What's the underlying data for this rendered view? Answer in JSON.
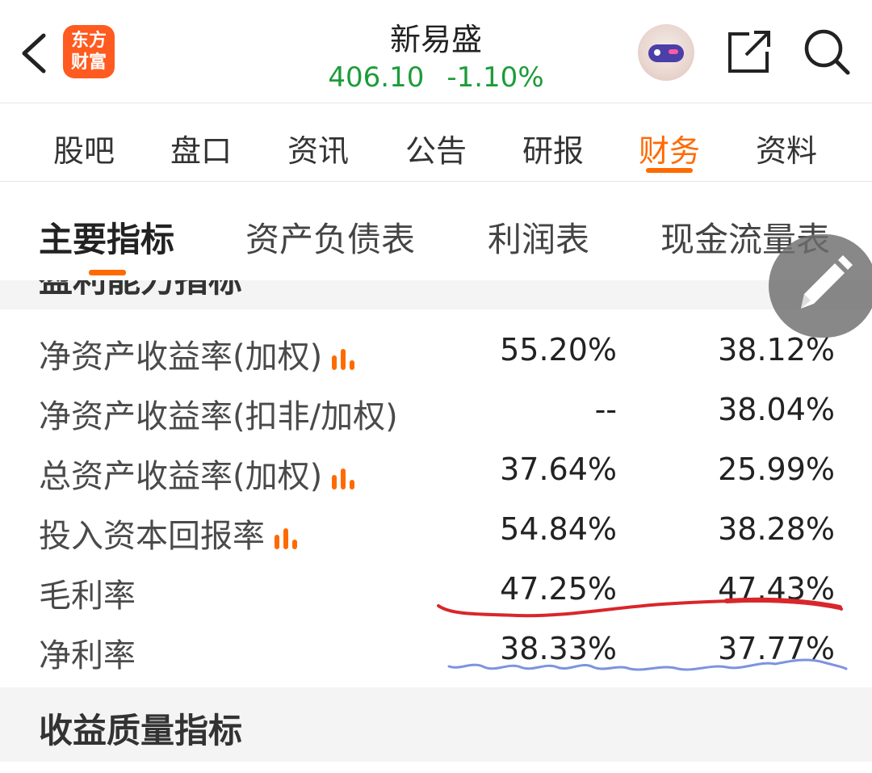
{
  "header": {
    "logo_line1": "东方",
    "logo_line2": "财富",
    "stock_name": "新易盛",
    "price": "406.10",
    "change_pct": "-1.10%"
  },
  "nav": {
    "tabs": [
      "股吧",
      "盘口",
      "资讯",
      "公告",
      "研报",
      "财务",
      "资料"
    ],
    "active": "财务"
  },
  "subnav": {
    "tabs": [
      "主要指标",
      "资产负债表",
      "利润表",
      "现金流量表"
    ],
    "active": "主要指标"
  },
  "section_partial_title": "盈利能力指标",
  "rows": [
    {
      "label": "净资产收益率(加权)",
      "has_chart_icon": true,
      "v1": "55.20%",
      "v2": "38.12%"
    },
    {
      "label": "净资产收益率(扣非/加权)",
      "has_chart_icon": false,
      "v1": "--",
      "v2": "38.04%"
    },
    {
      "label": "总资产收益率(加权)",
      "has_chart_icon": true,
      "v1": "37.64%",
      "v2": "25.99%"
    },
    {
      "label": "投入资本回报率",
      "has_chart_icon": true,
      "v1": "54.84%",
      "v2": "38.28%"
    },
    {
      "label": "毛利率",
      "has_chart_icon": false,
      "v1": "47.25%",
      "v2": "47.43%"
    },
    {
      "label": "净利率",
      "has_chart_icon": false,
      "v1": "38.33%",
      "v2": "37.77%"
    }
  ],
  "bottom_section_title": "收益质量指标",
  "colors": {
    "accent": "#ff6a00",
    "down": "#1d9c3a",
    "logo_bg": "#ff5a1f",
    "annotation_red": "#d9262b",
    "annotation_blue": "#7d93e0"
  },
  "icons": [
    "back-arrow-icon",
    "robot-avatar-icon",
    "share-icon",
    "search-icon",
    "bar-chart-icon",
    "pencil-icon"
  ]
}
